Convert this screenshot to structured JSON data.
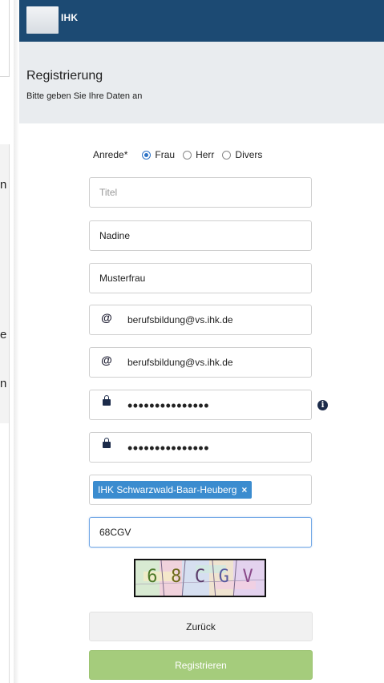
{
  "background_page": {
    "fragments": [
      "n",
      "e",
      "n"
    ]
  },
  "header": {
    "logo_text": "IHK",
    "title": "Registrierung",
    "subtitle": "Bitte geben Sie Ihre Daten an"
  },
  "form": {
    "anrede": {
      "label": "Anrede*",
      "options": [
        {
          "label": "Frau",
          "checked": true
        },
        {
          "label": "Herr",
          "checked": false
        },
        {
          "label": "Divers",
          "checked": false
        }
      ]
    },
    "titel": {
      "placeholder": "Titel",
      "value": ""
    },
    "vorname": {
      "value": "Nadine"
    },
    "nachname": {
      "value": "Musterfrau"
    },
    "email": {
      "value": "berufsbildung@vs.ihk.de",
      "icon": "at-icon"
    },
    "email_confirm": {
      "value": "berufsbildung@vs.ihk.de",
      "icon": "at-icon"
    },
    "password": {
      "masked": "•••••••••••••••",
      "icon": "lock-icon",
      "info": "i"
    },
    "password_confirm": {
      "masked": "•••••••••••••••",
      "icon": "lock-icon"
    },
    "chamber": {
      "tag_label": "IHK Schwarzwald-Baar-Heuberg",
      "remove": "×"
    },
    "captcha_input": {
      "value": "68CGV"
    },
    "captcha_image": {
      "characters": [
        "6",
        "8",
        "C",
        "G",
        "V"
      ]
    }
  },
  "buttons": {
    "back_label": "Zurück",
    "register_label": "Registrieren"
  },
  "colors": {
    "topbar": "#1c4a73",
    "header_bg": "#e9ecef",
    "accent": "#2e73c6",
    "tag": "#3b8ccf",
    "register_button": "#a5cc7c"
  }
}
